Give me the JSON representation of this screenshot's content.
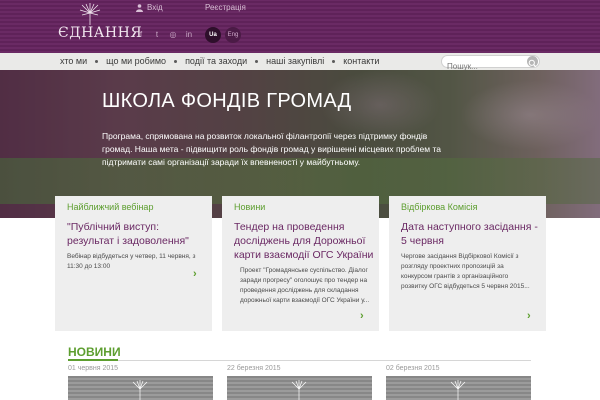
{
  "header": {
    "logo_text": "ЄДНАННЯ",
    "login_label": "Вхід",
    "register_label": "Реєстрація",
    "social_icons": [
      "facebook-icon",
      "twitter-icon",
      "instagram-icon",
      "linkedin-icon"
    ],
    "social_glyphs": [
      "f",
      "t",
      "◎",
      "in"
    ],
    "lang_ua": "Ua",
    "lang_en": "Eng",
    "colors": {
      "brand": "#6a2a64",
      "accent_green": "#5d9e2f"
    }
  },
  "nav": {
    "items": [
      {
        "label": "хто ми"
      },
      {
        "label": "що ми робимо"
      },
      {
        "label": "події та заходи"
      },
      {
        "label": "наші закупівлі"
      },
      {
        "label": "контакти"
      }
    ],
    "search_placeholder": "Пошук..."
  },
  "hero": {
    "title": "ШКОЛА ФОНДІВ ГРОМАД",
    "text": "Програма, спрямована на розвиток локальної філантропії через підтримку фондів громад. Наша мета - підвищити роль фондів громад у вирішенні місцевих проблем та підтримати самі організації заради їх впевненості у майбутньому."
  },
  "cards": [
    {
      "category": "Найближчий вебінар",
      "title": "\"Публічний виступ: результат і задоволення\"",
      "body": "Вебінар відбудеться у четвер, 11 червня, з 11:30 до 13:00"
    },
    {
      "category": "Новини",
      "title": "Тендер на проведення досліджень для Дорожньої карти взаємодії ОГС України",
      "body": "Проект \"Громадянське суспільство. Діалог заради прогресу\" оголошує про тендер на проведення досліджень для складання дорожньої карти взаємодії ОГС України у..."
    },
    {
      "category": "Відбіркова Комісія",
      "title": "Дата наступного засідання - 5 червня",
      "body": "Чергове засідання Відбіркової Комісії з розгляду проектних пропозицій за конкурсом грантів з організаційного розвитку ОГС відбудеться 5 червня 2015..."
    }
  ],
  "news": {
    "heading": "НОВИНИ",
    "dates": [
      "01 червня 2015",
      "22 березня 2015",
      "02 березня 2015"
    ]
  }
}
